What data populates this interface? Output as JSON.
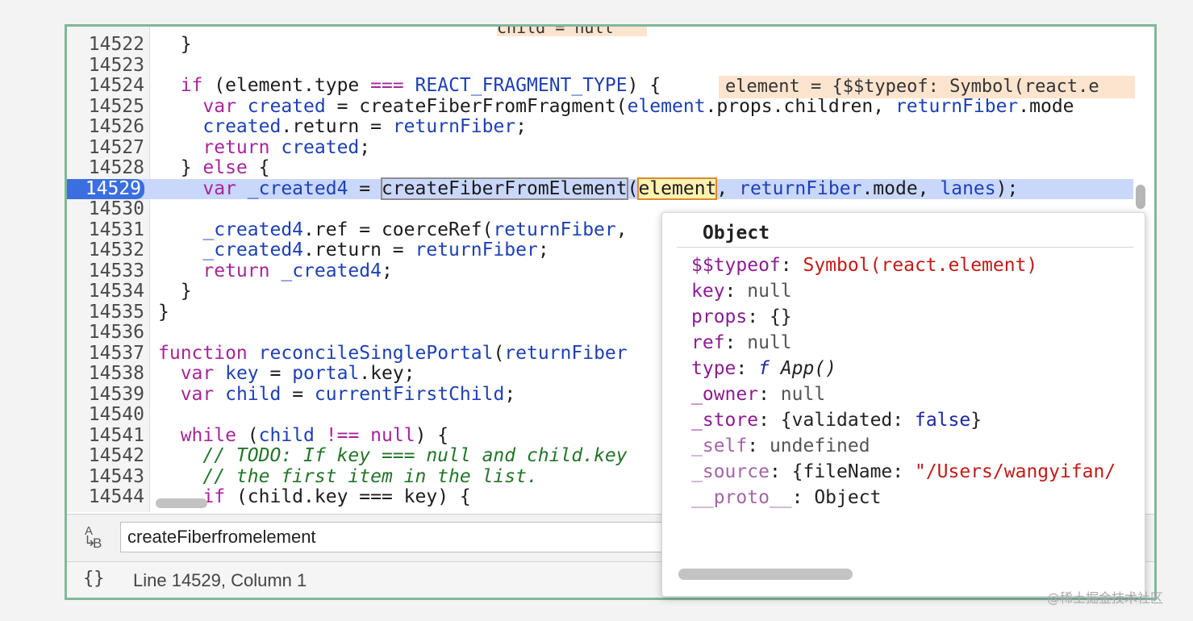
{
  "editor": {
    "top_inline_value": "child = null",
    "inline_value": "element = {$$typeof: Symbol(react.e",
    "lines": [
      {
        "n": "14522",
        "segs": [
          [
            "p",
            "  }"
          ]
        ]
      },
      {
        "n": "14523",
        "segs": []
      },
      {
        "n": "14524",
        "segs": [
          [
            "p",
            "  "
          ],
          [
            "k",
            "if"
          ],
          [
            "p",
            " (element.type "
          ],
          [
            "k",
            "==="
          ],
          [
            "p",
            " "
          ],
          [
            "v",
            "REACT_FRAGMENT_TYPE"
          ],
          [
            "p",
            ") {"
          ]
        ]
      },
      {
        "n": "14525",
        "segs": [
          [
            "p",
            "    "
          ],
          [
            "k",
            "var"
          ],
          [
            "p",
            " "
          ],
          [
            "v",
            "created"
          ],
          [
            "p",
            " = createFiberFromFragment("
          ],
          [
            "v",
            "element"
          ],
          [
            "p",
            ".props.children, "
          ],
          [
            "v",
            "returnFiber"
          ],
          [
            "p",
            ".mode"
          ]
        ]
      },
      {
        "n": "14526",
        "segs": [
          [
            "p",
            "    "
          ],
          [
            "v",
            "created"
          ],
          [
            "p",
            "."
          ],
          [
            "p",
            "return"
          ],
          [
            "p",
            " = "
          ],
          [
            "v",
            "returnFiber"
          ],
          [
            "p",
            ";"
          ]
        ]
      },
      {
        "n": "14527",
        "segs": [
          [
            "p",
            "    "
          ],
          [
            "k",
            "return"
          ],
          [
            "p",
            " "
          ],
          [
            "v",
            "created"
          ],
          [
            "p",
            ";"
          ]
        ]
      },
      {
        "n": "14528",
        "segs": [
          [
            "p",
            "  } "
          ],
          [
            "k",
            "else"
          ],
          [
            "p",
            " {"
          ]
        ]
      },
      {
        "n": "14529",
        "current": true,
        "segs": [
          [
            "p",
            "    "
          ],
          [
            "k",
            "var"
          ],
          [
            "p",
            " "
          ],
          [
            "v",
            "_created4"
          ],
          [
            "p",
            " = "
          ],
          [
            "box",
            "createFiberFromElement"
          ],
          [
            "p",
            "("
          ],
          [
            "hl",
            "element"
          ],
          [
            "p",
            ", "
          ],
          [
            "v",
            "returnFiber"
          ],
          [
            "p",
            ".mode, "
          ],
          [
            "v",
            "lanes"
          ],
          [
            "p",
            ");"
          ]
        ]
      },
      {
        "n": "14530",
        "segs": []
      },
      {
        "n": "14531",
        "segs": [
          [
            "p",
            "    "
          ],
          [
            "v",
            "_created4"
          ],
          [
            "p",
            ".ref = coerceRef("
          ],
          [
            "v",
            "returnFiber"
          ],
          [
            "p",
            ", "
          ]
        ]
      },
      {
        "n": "14532",
        "segs": [
          [
            "p",
            "    "
          ],
          [
            "v",
            "_created4"
          ],
          [
            "p",
            ".return = "
          ],
          [
            "v",
            "returnFiber"
          ],
          [
            "p",
            ";"
          ]
        ]
      },
      {
        "n": "14533",
        "segs": [
          [
            "p",
            "    "
          ],
          [
            "k",
            "return"
          ],
          [
            "p",
            " "
          ],
          [
            "v",
            "_created4"
          ],
          [
            "p",
            ";"
          ]
        ]
      },
      {
        "n": "14534",
        "segs": [
          [
            "p",
            "  }"
          ]
        ]
      },
      {
        "n": "14535",
        "segs": [
          [
            "p",
            "}"
          ]
        ]
      },
      {
        "n": "14536",
        "segs": []
      },
      {
        "n": "14537",
        "segs": [
          [
            "k",
            "function"
          ],
          [
            "p",
            " "
          ],
          [
            "v",
            "reconcileSinglePortal"
          ],
          [
            "p",
            "("
          ],
          [
            "v",
            "returnFiber"
          ]
        ]
      },
      {
        "n": "14538",
        "segs": [
          [
            "p",
            "  "
          ],
          [
            "k",
            "var"
          ],
          [
            "p",
            " "
          ],
          [
            "v",
            "key"
          ],
          [
            "p",
            " = "
          ],
          [
            "v",
            "portal"
          ],
          [
            "p",
            ".key;"
          ]
        ]
      },
      {
        "n": "14539",
        "segs": [
          [
            "p",
            "  "
          ],
          [
            "k",
            "var"
          ],
          [
            "p",
            " "
          ],
          [
            "v",
            "child"
          ],
          [
            "p",
            " = "
          ],
          [
            "v",
            "currentFirstChild"
          ],
          [
            "p",
            ";"
          ]
        ]
      },
      {
        "n": "14540",
        "segs": []
      },
      {
        "n": "14541",
        "segs": [
          [
            "p",
            "  "
          ],
          [
            "k",
            "while"
          ],
          [
            "p",
            " ("
          ],
          [
            "v",
            "child"
          ],
          [
            "p",
            " "
          ],
          [
            "k",
            "!=="
          ],
          [
            "p",
            " "
          ],
          [
            "k",
            "null"
          ],
          [
            "p",
            ") {"
          ]
        ]
      },
      {
        "n": "14542",
        "segs": [
          [
            "p",
            "    "
          ],
          [
            "c",
            "// TODO: If key === null and child.key"
          ]
        ]
      },
      {
        "n": "14543",
        "segs": [
          [
            "p",
            "    "
          ],
          [
            "c",
            "// the first item in the list."
          ]
        ]
      },
      {
        "n": "14544",
        "segs": [
          [
            "p",
            "    "
          ],
          [
            "k",
            "if"
          ],
          [
            "p",
            " (child.key === key) {"
          ]
        ]
      }
    ]
  },
  "popover": {
    "title": "Object",
    "props": [
      {
        "expand": false,
        "key": "$$typeof",
        "val": "Symbol(react.element)",
        "vcls": "pstr"
      },
      {
        "expand": false,
        "key": "key",
        "val": "null",
        "vcls": "pnull"
      },
      {
        "expand": true,
        "key": "props",
        "val": "{}",
        "vcls": ""
      },
      {
        "expand": false,
        "key": "ref",
        "val": "null",
        "vcls": "pnull"
      },
      {
        "expand": true,
        "key": "type",
        "fn": "f",
        "val": "App()",
        "vcls": "pital"
      },
      {
        "expand": false,
        "key": "_owner",
        "val": "null",
        "vcls": "pnull"
      },
      {
        "expand": true,
        "key": "_store",
        "val": "{validated: ",
        "val2": "false",
        "val3": "}",
        "vcls": ""
      },
      {
        "expand": false,
        "key": "_self",
        "val": "undefined",
        "vcls": "pnull",
        "dim": true
      },
      {
        "expand": true,
        "key": "_source",
        "val": "{fileName: ",
        "val2": "\"/Users/wangyifan/",
        "vcls": "",
        "dim": true
      },
      {
        "expand": true,
        "key": "__proto__",
        "val": "Object",
        "vcls": "",
        "dim": true
      }
    ]
  },
  "search": {
    "value": "createFiberfromelement"
  },
  "status": {
    "position": "Line 14529, Column 1"
  },
  "watermark": "@稀土掘金技术社区"
}
